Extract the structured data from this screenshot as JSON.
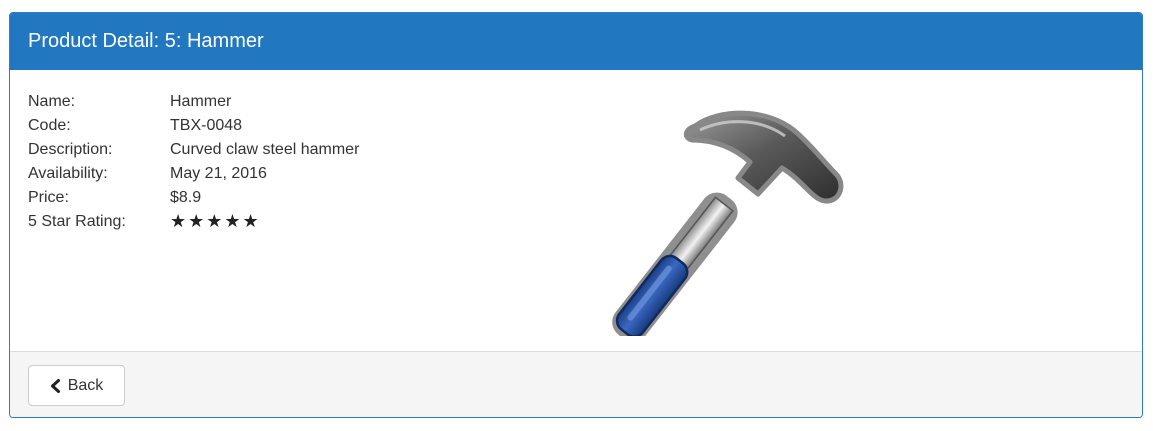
{
  "panel": {
    "title": "Product Detail: 5: Hammer"
  },
  "product": {
    "rows": [
      {
        "label": "Name:",
        "value": "Hammer"
      },
      {
        "label": "Code:",
        "value": "TBX-0048"
      },
      {
        "label": "Description:",
        "value": "Curved claw steel hammer"
      },
      {
        "label": "Availability:",
        "value": "May 21, 2016"
      },
      {
        "label": "Price:",
        "value": "$8.9"
      },
      {
        "label": "5 Star Rating:",
        "value": "★★★★★"
      }
    ],
    "rating": 5,
    "rating_max": 5,
    "image_icon": "hammer-icon"
  },
  "footer": {
    "back_label": "Back",
    "back_icon": "chevron-left-icon"
  },
  "colors": {
    "header_bg": "#2277c1",
    "header_text": "#ffffff",
    "footer_bg": "#f5f5f5",
    "handle_blue": "#2a55a6"
  }
}
